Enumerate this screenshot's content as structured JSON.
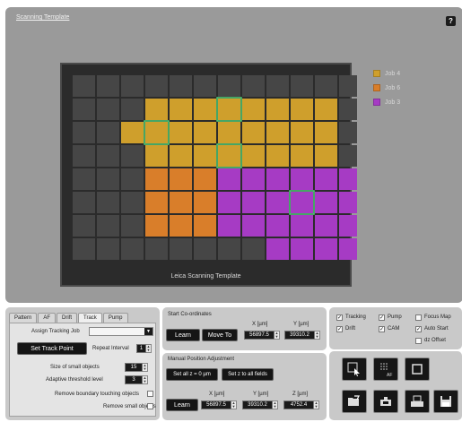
{
  "template_panel": {
    "title": "Scanning Template",
    "help_label": "?",
    "plate_caption": "Leica Scanning Template"
  },
  "legend": [
    {
      "label": "Job 4",
      "color": "#cf9f2c"
    },
    {
      "label": "Job 6",
      "color": "#d97e2a"
    },
    {
      "label": "Job 3",
      "color": "#a63bc4"
    }
  ],
  "grid": {
    "rows": 8,
    "cols": 12,
    "empty_color": "#464646",
    "highlight_color": "#4fcf79",
    "cells": [
      "............",
      "...44444444.",
      "..444444444.",
      "...44444444.",
      "...666333333",
      "...666333333",
      "...666333333",
      "........3333"
    ],
    "highlights": [
      [
        1,
        6
      ],
      [
        2,
        3
      ],
      [
        3,
        6
      ],
      [
        5,
        9
      ]
    ]
  },
  "tabs_panel": {
    "tabs": [
      "Pattern",
      "AF",
      "Drift",
      "Track",
      "Pump"
    ],
    "active_tab": "Track",
    "assign_tracking_job_label": "Assign Tracking Job",
    "set_track_point_label": "Set Track Point",
    "repeat_interval_label": "Repeat Interval",
    "repeat_interval_value": "1",
    "size_small_objects_label": "Size of small objects",
    "size_small_objects_value": "15",
    "adaptive_threshold_label": "Adaptive threshold level",
    "adaptive_threshold_value": "3",
    "remove_boundary_label": "Remove boundary touching objects",
    "remove_small_label": "Remove small objects"
  },
  "start_coords": {
    "title": "Start Co-ordinates",
    "x_label": "X [µm]",
    "y_label": "Y [µm]",
    "learn_label": "Learn",
    "move_to_label": "Move To",
    "x_value": "56897.5",
    "y_value": "39310.2"
  },
  "manual_adjust": {
    "title": "Manual Position Adjustment",
    "set_all_z0_label": "Set all z = 0 µm",
    "set_z_all_label": "Set z to all fields",
    "x_label": "X [µm]",
    "y_label": "Y [µm]",
    "z_label": "Z [µm]",
    "learn_label": "Learn",
    "x_value": "56897.5",
    "y_value": "39310.2",
    "z_value": "4752.4"
  },
  "checks": {
    "tracking": {
      "label": "Tracking",
      "checked": true
    },
    "pump": {
      "label": "Pump",
      "checked": true
    },
    "focus_map": {
      "label": "Focus Map",
      "checked": false
    },
    "drift": {
      "label": "Drift",
      "checked": true
    },
    "cam": {
      "label": "CAM",
      "checked": true
    },
    "auto_start": {
      "label": "Auto Start",
      "checked": true
    },
    "dz_offset": {
      "label": "dz Offset",
      "checked": false
    }
  },
  "tools": {
    "af_label": "AF"
  }
}
